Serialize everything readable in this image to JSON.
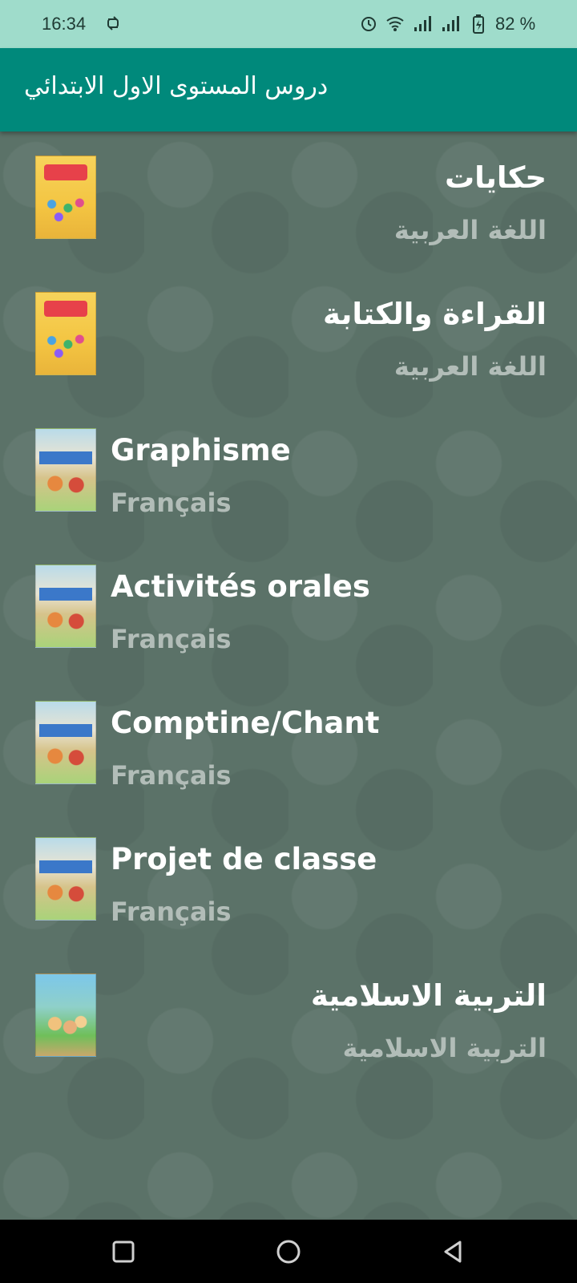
{
  "status_bar": {
    "time": "16:34",
    "battery": "82 %",
    "icons": [
      "sync-icon",
      "alarm-icon",
      "wifi-icon",
      "signal-icon",
      "signal-icon",
      "battery-charging-icon"
    ]
  },
  "app_bar": {
    "title": "دروس المستوى الاول الابتدائي"
  },
  "items": [
    {
      "title": "حكايات",
      "subtitle": "اللغة العربية",
      "dir": "rtl"
    },
    {
      "title": "القراءة والكتابة",
      "subtitle": "اللغة العربية",
      "dir": "rtl"
    },
    {
      "title": "Graphisme",
      "subtitle": "Français",
      "dir": "ltr"
    },
    {
      "title": "Activités orales",
      "subtitle": "Français",
      "dir": "ltr"
    },
    {
      "title": "Comptine/Chant",
      "subtitle": "Français",
      "dir": "ltr"
    },
    {
      "title": "Projet de classe",
      "subtitle": "Français",
      "dir": "ltr"
    },
    {
      "title": "التربية الاسلامية",
      "subtitle": "التربية الاسلامية",
      "dir": "rtl"
    }
  ],
  "nav_bar": {
    "icons": [
      "recents-square-icon",
      "home-circle-icon",
      "back-triangle-icon"
    ]
  },
  "colors": {
    "status_bar_bg": "#9fdccb",
    "app_bar_bg": "#00897b",
    "list_bg": "#5b7268",
    "title_text": "#ffffff",
    "subtitle_text": "#b2bdb8"
  }
}
